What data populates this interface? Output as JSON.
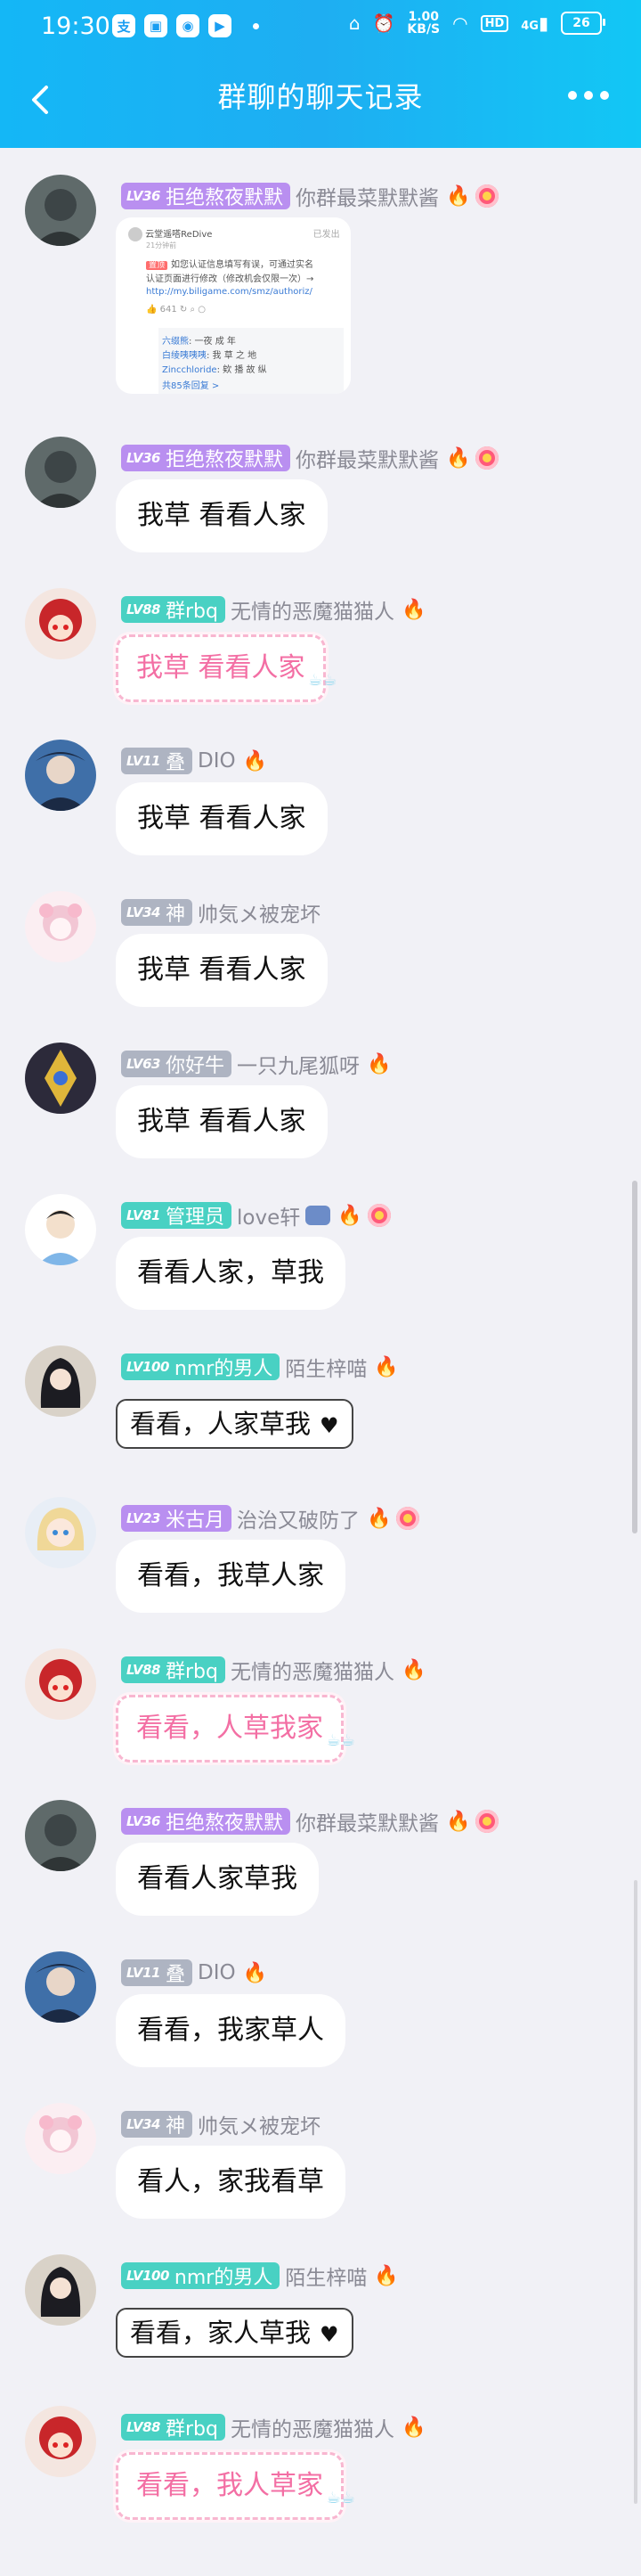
{
  "status_bar": {
    "time": "19:30",
    "speed_top": "1.00",
    "speed_unit": "KB/S",
    "hd": "HD",
    "signal": "4G",
    "battery": "26",
    "apps": [
      "alipay-icon",
      "app-icon",
      "app-icon",
      "video-icon"
    ]
  },
  "header": {
    "title": "群聊的聊天记录"
  },
  "image_card": {
    "author": "云堂遥嗒ReDive",
    "time": "21分钟前",
    "badge": "已发出",
    "tag": "置顶",
    "line1": "如您认证信息填写有误，可通过实名",
    "line2": "认证页面进行修改（修改机会仅限一次）→",
    "link": "http://my.biligame.com/smz/authoriz/",
    "count": "641",
    "reply1_name": "六缀熊",
    "reply1_text": ": 一夜 成 年",
    "reply2_name": "白绫咦咦咦",
    "reply2_text": ": 我 草 之 地",
    "reply3_name": "Zincchloride",
    "reply3_text": ": 欸 播 故 纵",
    "more": "共85条回复 >"
  },
  "messages": [
    {
      "level": "LV36",
      "title": "拒绝熬夜默默",
      "name": "你群最菜默默酱",
      "text": ""
    },
    {
      "level": "LV36",
      "title": "拒绝熬夜默默",
      "name": "你群最菜默默酱",
      "text": "我草 看看人家"
    },
    {
      "level": "LV88",
      "title": "群rbq",
      "name": "无情的恶魔猫猫人",
      "text": "我草 看看人家"
    },
    {
      "level": "LV11",
      "title": "叠",
      "name": "DIO",
      "text": "我草 看看人家"
    },
    {
      "level": "LV34",
      "title": "神",
      "name": "帅気メ被宠坏",
      "text": "我草 看看人家"
    },
    {
      "level": "LV63",
      "title": "你好牛",
      "name": "一只九尾狐呀",
      "text": "我草 看看人家"
    },
    {
      "level": "LV81",
      "title": "管理员",
      "name": "love轩",
      "text": "看看人家，草我"
    },
    {
      "level": "LV100",
      "title": "nmr的男人",
      "name": "陌生梓喵",
      "text": "看看，人家草我"
    },
    {
      "level": "LV23",
      "title": "米古月",
      "name": "治治又破防了",
      "text": "看看，我草人家"
    },
    {
      "level": "LV88",
      "title": "群rbq",
      "name": "无情的恶魔猫猫人",
      "text": "看看，人草我家"
    },
    {
      "level": "LV36",
      "title": "拒绝熬夜默默",
      "name": "你群最菜默默酱",
      "text": "看看人家草我"
    },
    {
      "level": "LV11",
      "title": "叠",
      "name": "DIO",
      "text": "看看，我家草人"
    },
    {
      "level": "LV34",
      "title": "神",
      "name": "帅気メ被宠坏",
      "text": "看人，家我看草"
    },
    {
      "level": "LV100",
      "title": "nmr的男人",
      "name": "陌生梓喵",
      "text": "看看，家人草我"
    },
    {
      "level": "LV88",
      "title": "群rbq",
      "name": "无情的恶魔猫猫人",
      "text": "看看，我人草家"
    }
  ],
  "colors": {
    "header": "#1eaef2",
    "tag_purple": "#b98ff0",
    "tag_teal": "#49d1c3",
    "tag_gray": "#aeb4c2",
    "pink_text": "#f36fa4"
  }
}
